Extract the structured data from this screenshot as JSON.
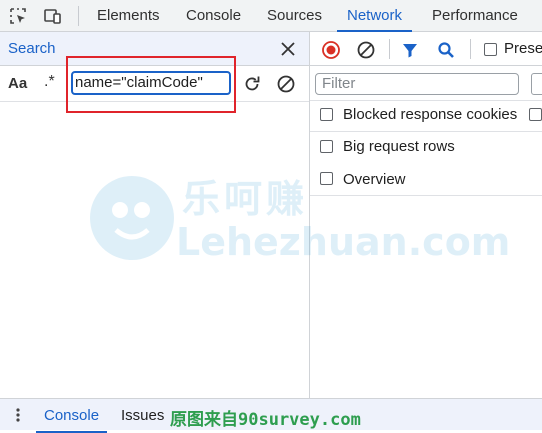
{
  "tabs": [
    {
      "label": "Elements",
      "active": false
    },
    {
      "label": "Console",
      "active": false
    },
    {
      "label": "Sources",
      "active": false
    },
    {
      "label": "Network",
      "active": true
    },
    {
      "label": "Performance",
      "active": false
    }
  ],
  "search_panel": {
    "title": "Search",
    "match_case_label": "Aa",
    "regex_label": ".*",
    "query": "name=\"claimCode\""
  },
  "network": {
    "preserve_log_label": "Prese",
    "filter_placeholder": "Filter",
    "options": [
      {
        "label": "Blocked response cookies",
        "checked": false
      },
      {
        "label": "Big request rows",
        "checked": false
      },
      {
        "label": "Overview",
        "checked": false
      }
    ]
  },
  "watermark": {
    "chinese": "乐呵赚",
    "latin": "Lehezhuan.com"
  },
  "drawer": {
    "tabs": [
      {
        "label": "Console",
        "active": true
      },
      {
        "label": "Issues",
        "active": false
      }
    ],
    "source_caption": "原图来自90survey.com"
  },
  "colors": {
    "accent": "#1a62c8",
    "record_stop": "#d93025",
    "highlight_box": "#e0242b",
    "caption_green": "#2e9e4f"
  }
}
